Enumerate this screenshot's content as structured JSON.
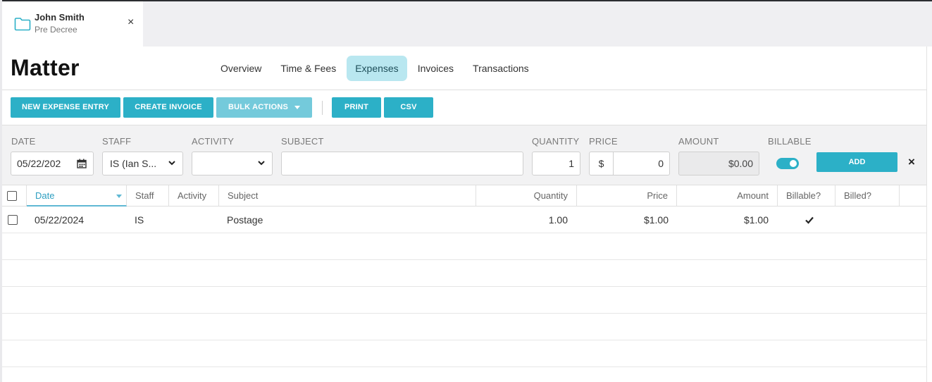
{
  "tab": {
    "title": "John Smith",
    "subtitle": "Pre Decree",
    "close": "×"
  },
  "page": {
    "title": "Matter"
  },
  "nav": [
    "Overview",
    "Time & Fees",
    "Expenses",
    "Invoices",
    "Transactions"
  ],
  "nav_active": "Expenses",
  "toolbar": {
    "new_expense": "NEW EXPENSE ENTRY",
    "create_invoice": "CREATE INVOICE",
    "bulk_actions": "BULK ACTIONS",
    "print": "PRINT",
    "csv": "CSV"
  },
  "form": {
    "labels": {
      "date": "DATE",
      "staff": "STAFF",
      "activity": "ACTIVITY",
      "subject": "SUBJECT",
      "quantity": "QUANTITY",
      "price": "PRICE",
      "amount": "AMOUNT",
      "billable": "BILLABLE"
    },
    "date_value": "05/22/202",
    "staff_value": "IS (Ian S...",
    "activity_value": "",
    "subject_value": "",
    "quantity_value": "1",
    "price_symbol": "$",
    "price_value": "0",
    "amount_value": "$0.00",
    "billable": true,
    "add_label": "ADD",
    "close": "×"
  },
  "table": {
    "headers": [
      "Date",
      "Staff",
      "Activity",
      "Subject",
      "Quantity",
      "Price",
      "Amount",
      "Billable?",
      "Billed?"
    ],
    "sorted_column": "Date",
    "rows": [
      {
        "date": "05/22/2024",
        "staff": "IS",
        "activity": "",
        "subject": "Postage",
        "quantity": "1.00",
        "price": "$1.00",
        "amount": "$1.00",
        "billable": true,
        "billed": false
      }
    ]
  },
  "colors": {
    "accent": "#2cb0c7",
    "accent_disabled": "#74cadb",
    "nav_active_bg": "#b9e7f0"
  }
}
